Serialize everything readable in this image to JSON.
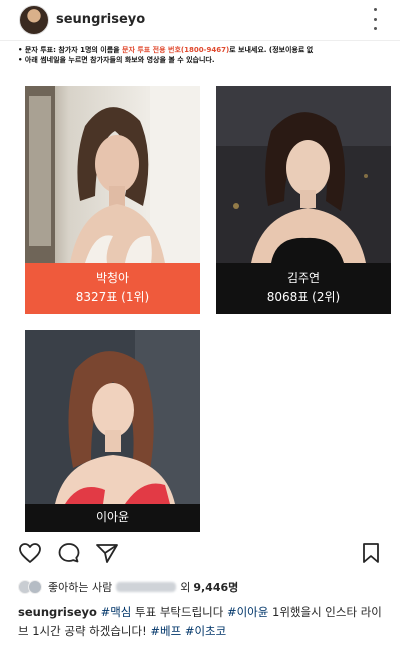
{
  "header": {
    "username": "seungriseyo"
  },
  "notice": {
    "line1_prefix": "• 문자 투표: 참가자 1명의 이름을 ",
    "line1_red": "문자 투표 전용 번호(1800-9467)",
    "line1_suffix": "로 보내세요. (정보이용료 없",
    "line2": "• 아래 썸네일을 누르면 참가자들의 화보와 영상을 볼 수 있습니다."
  },
  "contestants": [
    {
      "name": "박청아",
      "votes": "8327표 (1위)"
    },
    {
      "name": "김주연",
      "votes": "8068표 (2위)"
    },
    {
      "name": "이아윤"
    }
  ],
  "likes": {
    "prefix": "좋아하는 사람",
    "middle": "외",
    "count": "9,446명"
  },
  "caption": {
    "username": "seungriseyo",
    "tag1": "#맥심",
    "text1": " 투표 부탁드립니다 ",
    "tag2": "#이아윤",
    "text2": " 1위했을시 인스타 라이브 1시간 공략 하겠습니다! ",
    "tag3": "#베프",
    "tag4": "#이초코"
  },
  "colors": {
    "winner_bar": "#ef5a3c",
    "bar": "#111111",
    "notice_red": "#e04a2f",
    "hashtag": "#003569"
  },
  "icons": [
    "more-icon",
    "heart-icon",
    "comment-icon",
    "share-icon",
    "bookmark-icon"
  ]
}
